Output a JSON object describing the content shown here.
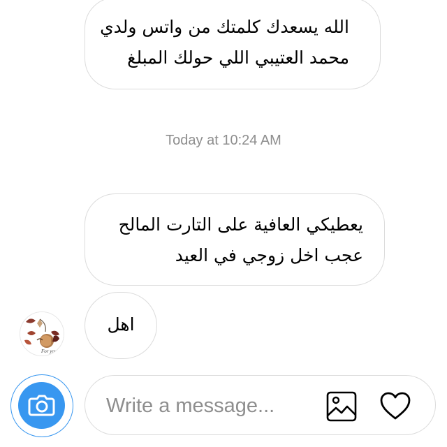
{
  "messages": [
    {
      "id": "m1",
      "lines": [
        "الله يسعدك كلمتك من واتس ولدي",
        "محمد العتيبي اللي حولك المبلغ"
      ]
    },
    {
      "id": "m2",
      "lines": [
        "يعطيكي العافية على التارت المالح",
        "عجب اخل زوجي في العيد"
      ]
    },
    {
      "id": "m3",
      "lines": [
        "اهل"
      ]
    }
  ],
  "timestamp": "Today at 10:24 AM",
  "composer": {
    "placeholder": "Write a message...",
    "icons": [
      "camera-icon",
      "gallery-icon",
      "heart-icon"
    ]
  },
  "colors": {
    "accent": "#3897f0",
    "bubble_border": "#dbdbdb",
    "muted_text": "#8e8e8e"
  }
}
